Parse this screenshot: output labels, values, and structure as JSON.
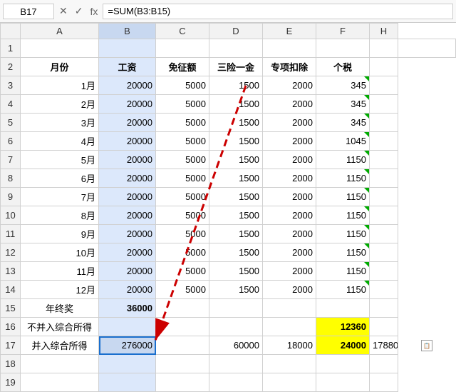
{
  "formulaBar": {
    "cellRef": "B17",
    "formula": "=SUM(B3:B15)",
    "cancelIcon": "✕",
    "confirmIcon": "✓",
    "fxLabel": "fx"
  },
  "columns": {
    "headers": [
      "",
      "A",
      "B",
      "C",
      "D",
      "E",
      "F",
      "H"
    ]
  },
  "rows": [
    {
      "rowNum": "1",
      "cells": [
        "",
        "",
        "",
        "",
        "",
        "",
        "",
        ""
      ]
    },
    {
      "rowNum": "2",
      "cells": [
        "月份",
        "工资",
        "免征额",
        "三险一金",
        "专项扣除",
        "个税",
        ""
      ]
    },
    {
      "rowNum": "3",
      "cells": [
        "1月",
        "20000",
        "5000",
        "1500",
        "2000",
        "345",
        ""
      ]
    },
    {
      "rowNum": "4",
      "cells": [
        "2月",
        "20000",
        "5000",
        "1500",
        "2000",
        "345",
        ""
      ]
    },
    {
      "rowNum": "5",
      "cells": [
        "3月",
        "20000",
        "5000",
        "1500",
        "2000",
        "345",
        ""
      ]
    },
    {
      "rowNum": "6",
      "cells": [
        "4月",
        "20000",
        "5000",
        "1500",
        "2000",
        "1045",
        ""
      ]
    },
    {
      "rowNum": "7",
      "cells": [
        "5月",
        "20000",
        "5000",
        "1500",
        "2000",
        "1150",
        ""
      ]
    },
    {
      "rowNum": "8",
      "cells": [
        "6月",
        "20000",
        "5000",
        "1500",
        "2000",
        "1150",
        ""
      ]
    },
    {
      "rowNum": "9",
      "cells": [
        "7月",
        "20000",
        "5000",
        "1500",
        "2000",
        "1150",
        ""
      ]
    },
    {
      "rowNum": "10",
      "cells": [
        "8月",
        "20000",
        "5000",
        "1500",
        "2000",
        "1150",
        ""
      ]
    },
    {
      "rowNum": "11",
      "cells": [
        "9月",
        "20000",
        "5000",
        "1500",
        "2000",
        "1150",
        ""
      ]
    },
    {
      "rowNum": "12",
      "cells": [
        "10月",
        "20000",
        "5000",
        "1500",
        "2000",
        "1150",
        ""
      ]
    },
    {
      "rowNum": "13",
      "cells": [
        "11月",
        "20000",
        "5000",
        "1500",
        "2000",
        "1150",
        ""
      ]
    },
    {
      "rowNum": "14",
      "cells": [
        "12月",
        "20000",
        "5000",
        "1500",
        "2000",
        "1150",
        ""
      ]
    },
    {
      "rowNum": "15",
      "cells": [
        "年终奖",
        "36000",
        "",
        "",
        "",
        "",
        ""
      ]
    },
    {
      "rowNum": "16",
      "cells": [
        "不并入综合所得",
        "",
        "",
        "",
        "",
        "12360",
        ""
      ]
    },
    {
      "rowNum": "17",
      "cells": [
        "并入综合所得",
        "276000",
        "",
        "60000",
        "18000",
        "24000",
        "17880"
      ]
    },
    {
      "rowNum": "18",
      "cells": [
        "",
        "",
        "",
        "",
        "",
        "",
        ""
      ]
    },
    {
      "rowNum": "19",
      "cells": [
        "",
        "",
        "",
        "",
        "",
        "",
        ""
      ]
    }
  ]
}
